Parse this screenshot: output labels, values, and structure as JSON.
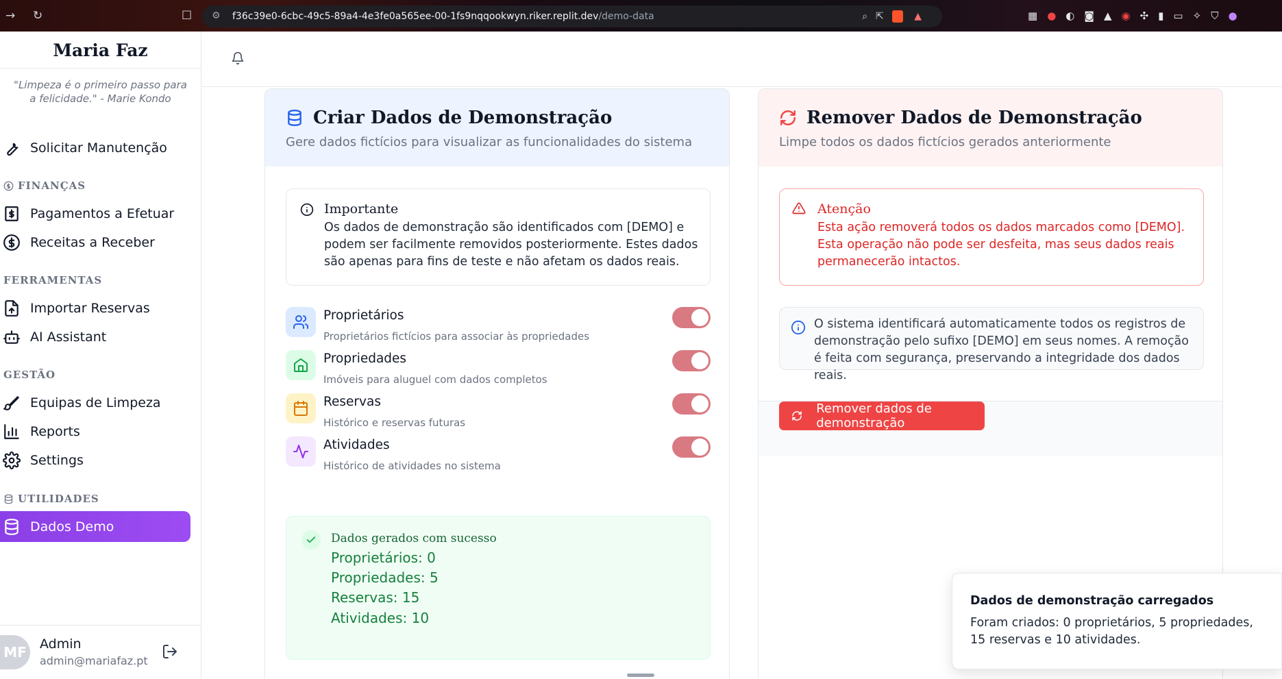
{
  "browser": {
    "url_host": "f36c39e0-6cbc-49c5-89a4-4e3fe0a565ee-00-1fs9nqqookwyn.riker.replit.dev",
    "url_path": "/demo-data"
  },
  "sidebar": {
    "brand": "Maria Faz",
    "quote": "\"Limpeza é o primeiro passo para a felicidade.\" - Marie Kondo",
    "items": [
      {
        "label": "Solicitar Manutenção",
        "icon": "wrench-icon"
      },
      {
        "label": "Pagamentos a Efetuar",
        "icon": "receipt-dollar-icon"
      },
      {
        "label": "Receitas a Receber",
        "icon": "circle-dollar-icon"
      },
      {
        "label": "Importar Reservas",
        "icon": "file-upload-icon"
      },
      {
        "label": "AI Assistant",
        "icon": "bot-icon"
      },
      {
        "label": "Equipas de Limpeza",
        "icon": "brush-icon"
      },
      {
        "label": "Reports",
        "icon": "bar-chart-icon"
      },
      {
        "label": "Settings",
        "icon": "gear-icon"
      },
      {
        "label": "Dados Demo",
        "icon": "database-icon"
      }
    ],
    "sections": {
      "financas": "FINANÇAS",
      "ferramentas": "FERRAMENTAS",
      "gestao": "GESTÃO",
      "utilidades": "UTILIDADES"
    },
    "user": {
      "initials": "MF",
      "name": "Admin",
      "email": "admin@mariafaz.pt"
    }
  },
  "create_card": {
    "title": "Criar Dados de Demonstração",
    "subtitle": "Gere dados fictícios para visualizar as funcionalidades do sistema",
    "notice_title": "Importante",
    "notice_text": "Os dados de demonstração são identificados com [DEMO] e podem ser facilmente removidos posteriormente. Estes dados são apenas para fins de teste e não afetam os dados reais.",
    "options": [
      {
        "label": "Proprietários",
        "desc": "Proprietários fictícios para associar às propriedades",
        "enabled": true,
        "color": "#dbeafe"
      },
      {
        "label": "Propriedades",
        "desc": "Imóveis para aluguel com dados completos",
        "enabled": true,
        "color": "#dcfce7"
      },
      {
        "label": "Reservas",
        "desc": "Histórico e reservas futuras",
        "enabled": true,
        "color": "#fef3c7"
      },
      {
        "label": "Atividades",
        "desc": "Histórico de atividades no sistema",
        "enabled": true,
        "color": "#f3e8ff"
      }
    ],
    "success_title": "Dados gerados com sucesso",
    "success_lines": [
      "Proprietários: 0",
      "Propriedades: 5",
      "Reservas: 15",
      "Atividades: 10"
    ]
  },
  "remove_card": {
    "title": "Remover Dados de Demonstração",
    "subtitle": "Limpe todos os dados fictícios gerados anteriormente",
    "warn_title": "Atenção",
    "warn_text": "Esta ação removerá todos os dados marcados como [DEMO]. Esta operação não pode ser desfeita, mas seus dados reais permanecerão intactos.",
    "info_text": "O sistema identificará automaticamente todos os registros de demonstração pelo sufixo [DEMO] em seus nomes. A remoção é feita com segurança, preservando a integridade dos dados reais.",
    "button_label": "Remover dados de demonstração"
  },
  "toast": {
    "title": "Dados de demonstração carregados",
    "message": "Foram criados: 0 proprietários, 5 propriedades, 15 reservas e 10 atividades."
  },
  "colors": {
    "accent": "#9333ea",
    "danger": "#ef4444",
    "success": "#15803d",
    "toggle": "#d97a83"
  }
}
